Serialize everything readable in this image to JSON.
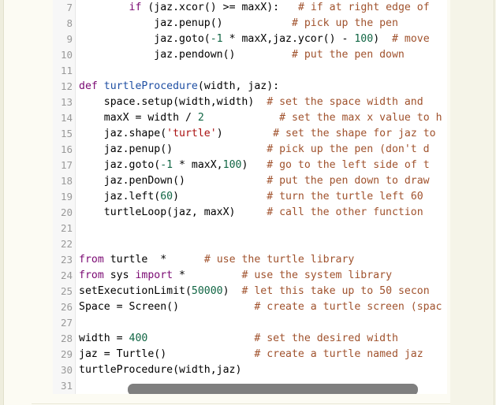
{
  "editor": {
    "lines": [
      {
        "n": "7",
        "t": [
          [
            "",
            "        "
          ],
          [
            "kw",
            "if"
          ],
          [
            "",
            " (jaz.xcor() "
          ],
          [
            "",
            ">="
          ],
          [
            "",
            " maxX):   "
          ],
          [
            "cm",
            "# if at right edge of"
          ]
        ]
      },
      {
        "n": "8",
        "t": [
          [
            "",
            "            jaz.penup()           "
          ],
          [
            "cm",
            "# pick up the pen"
          ]
        ]
      },
      {
        "n": "9",
        "t": [
          [
            "",
            "            jaz.goto("
          ],
          [
            "num",
            "-1"
          ],
          [
            "",
            " * maxX,jaz.ycor() - "
          ],
          [
            "num",
            "100"
          ],
          [
            "",
            ")  "
          ],
          [
            "cm",
            "# move"
          ]
        ]
      },
      {
        "n": "10",
        "t": [
          [
            "",
            "            jaz.pendown()         "
          ],
          [
            "cm",
            "# put the pen down"
          ]
        ]
      },
      {
        "n": "11",
        "t": []
      },
      {
        "n": "12",
        "t": [
          [
            "kw",
            "def"
          ],
          [
            "",
            " "
          ],
          [
            "fn",
            "turtleProcedure"
          ],
          [
            "",
            "(width, jaz):"
          ]
        ]
      },
      {
        "n": "13",
        "t": [
          [
            "",
            "    space.setup(width,width)  "
          ],
          [
            "cm",
            "# set the space width and"
          ]
        ]
      },
      {
        "n": "14",
        "t": [
          [
            "",
            "    maxX = width / "
          ],
          [
            "num",
            "2"
          ],
          [
            "",
            "            "
          ],
          [
            "cm",
            "# set the max x value to h"
          ]
        ]
      },
      {
        "n": "15",
        "t": [
          [
            "",
            "    jaz.shape("
          ],
          [
            "str",
            "'turtle'"
          ],
          [
            "",
            ")        "
          ],
          [
            "cm",
            "# set the shape for jaz to"
          ]
        ]
      },
      {
        "n": "16",
        "t": [
          [
            "",
            "    jaz.penup()               "
          ],
          [
            "cm",
            "# pick up the pen (don't d"
          ]
        ]
      },
      {
        "n": "17",
        "t": [
          [
            "",
            "    jaz.goto("
          ],
          [
            "num",
            "-1"
          ],
          [
            "",
            " * maxX,"
          ],
          [
            "num",
            "100"
          ],
          [
            "",
            ")   "
          ],
          [
            "cm",
            "# go to the left side of t"
          ]
        ]
      },
      {
        "n": "18",
        "t": [
          [
            "",
            "    jaz.penDown()             "
          ],
          [
            "cm",
            "# put the pen down to draw"
          ]
        ]
      },
      {
        "n": "19",
        "t": [
          [
            "",
            "    jaz.left("
          ],
          [
            "num",
            "60"
          ],
          [
            "",
            ")              "
          ],
          [
            "cm",
            "# turn the turtle left 60"
          ]
        ]
      },
      {
        "n": "20",
        "t": [
          [
            "",
            "    turtleLoop(jaz, maxX)     "
          ],
          [
            "cm",
            "# call the other function"
          ]
        ]
      },
      {
        "n": "21",
        "t": []
      },
      {
        "n": "22",
        "t": []
      },
      {
        "n": "23",
        "t": [
          [
            "kw",
            "from"
          ],
          [
            "",
            " turtle  *      "
          ],
          [
            "cm",
            "# use the turtle library"
          ]
        ]
      },
      {
        "n": "24",
        "t": [
          [
            "kw",
            "from"
          ],
          [
            "",
            " sys "
          ],
          [
            "kw",
            "import"
          ],
          [
            "",
            " *         "
          ],
          [
            "cm",
            "# use the system library"
          ]
        ]
      },
      {
        "n": "25",
        "t": [
          [
            "",
            "setExecutionLimit("
          ],
          [
            "num",
            "50000"
          ],
          [
            "",
            ")  "
          ],
          [
            "cm",
            "# let this take up to 50 secon"
          ]
        ]
      },
      {
        "n": "26",
        "t": [
          [
            "",
            "Space = Screen()            "
          ],
          [
            "cm",
            "# create a turtle screen (spac"
          ]
        ]
      },
      {
        "n": "27",
        "t": []
      },
      {
        "n": "28",
        "t": [
          [
            "",
            "width = "
          ],
          [
            "num",
            "400"
          ],
          [
            "",
            "                 "
          ],
          [
            "cm",
            "# set the desired width"
          ]
        ]
      },
      {
        "n": "29",
        "t": [
          [
            "",
            "jaz = Turtle()              "
          ],
          [
            "cm",
            "# create a turtle named jaz"
          ]
        ]
      },
      {
        "n": "30",
        "t": [
          [
            "",
            "turtleProcedure(width,jaz)"
          ]
        ]
      },
      {
        "n": "31",
        "t": []
      }
    ]
  }
}
